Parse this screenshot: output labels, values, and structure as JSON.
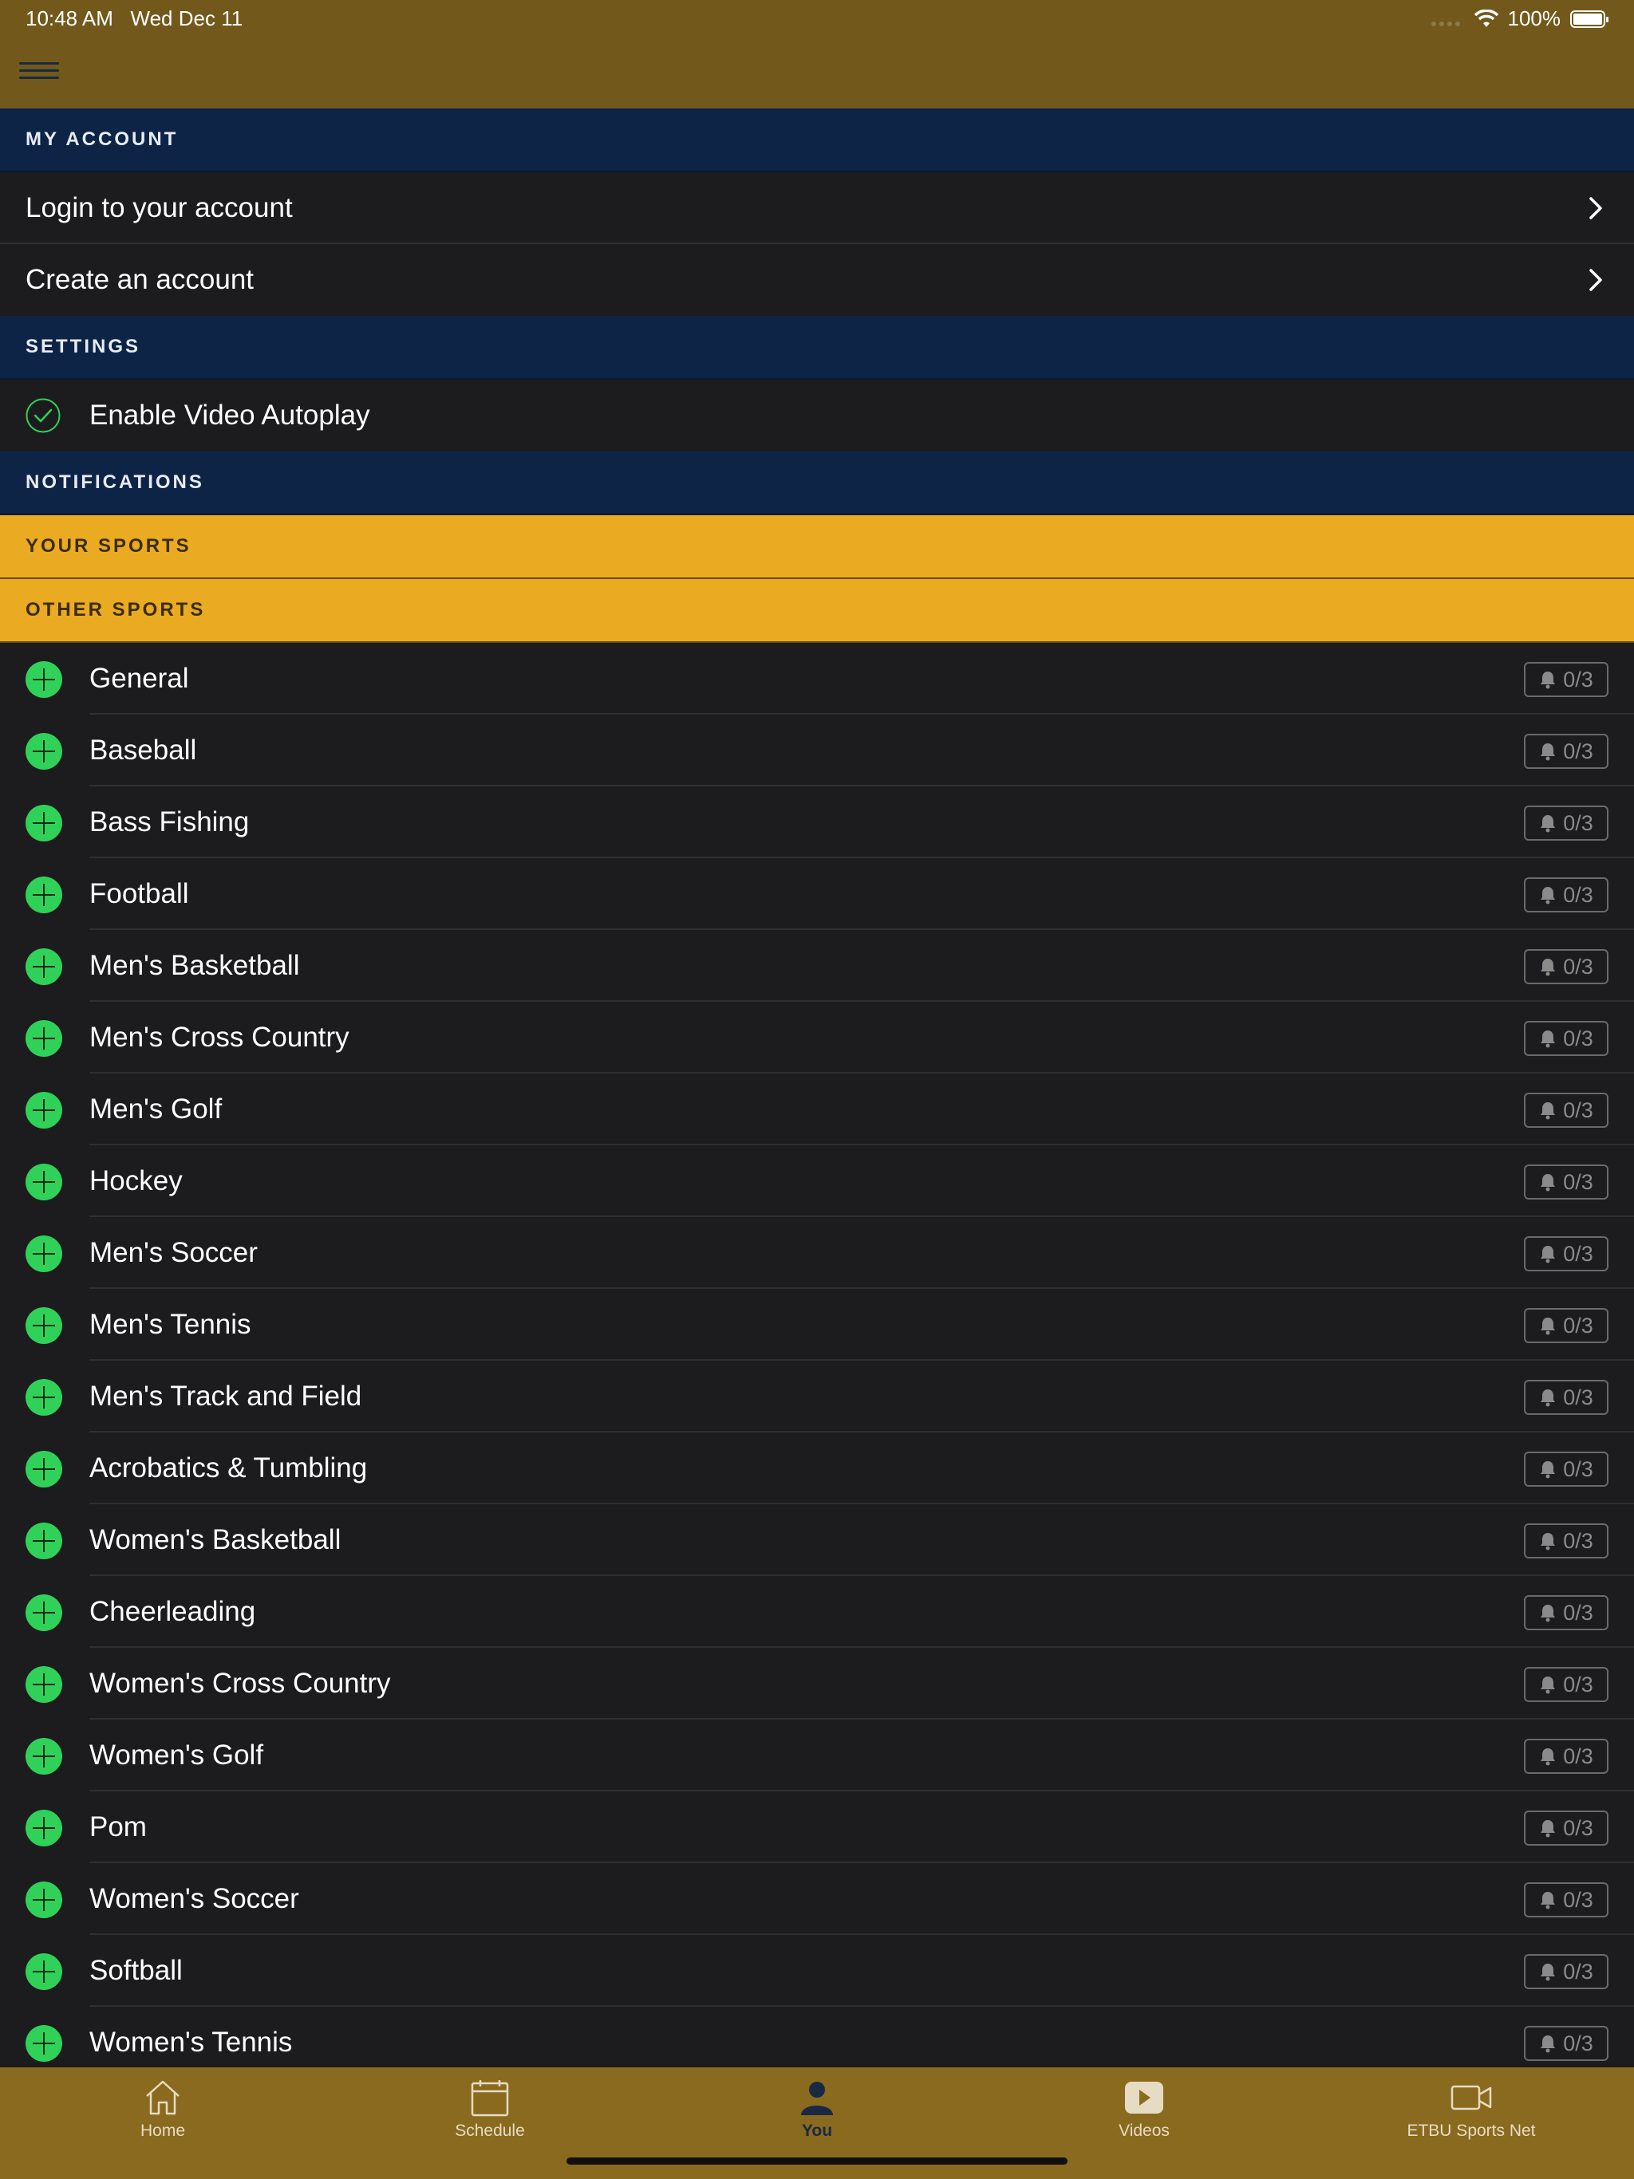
{
  "status": {
    "time": "10:48 AM",
    "date": "Wed Dec 11",
    "battery": "100%"
  },
  "nav": {
    "menu_icon": "hamburger-menu-icon"
  },
  "sections": {
    "my_account": "MY ACCOUNT",
    "settings": "SETTINGS",
    "notifications": "NOTIFICATIONS",
    "your_sports": "YOUR SPORTS",
    "other_sports": "OTHER SPORTS"
  },
  "account": {
    "items": [
      {
        "label": "Login to your account"
      },
      {
        "label": "Create an account"
      }
    ]
  },
  "settings": {
    "items": [
      {
        "label": "Enable Video Autoplay",
        "checked": true
      }
    ]
  },
  "sports": {
    "items": [
      {
        "label": "General",
        "badge": "0/3"
      },
      {
        "label": "Baseball",
        "badge": "0/3"
      },
      {
        "label": "Bass Fishing",
        "badge": "0/3"
      },
      {
        "label": "Football",
        "badge": "0/3"
      },
      {
        "label": "Men's Basketball",
        "badge": "0/3"
      },
      {
        "label": "Men's Cross Country",
        "badge": "0/3"
      },
      {
        "label": "Men's Golf",
        "badge": "0/3"
      },
      {
        "label": "Hockey",
        "badge": "0/3"
      },
      {
        "label": "Men's Soccer",
        "badge": "0/3"
      },
      {
        "label": "Men's Tennis",
        "badge": "0/3"
      },
      {
        "label": "Men's Track and Field",
        "badge": "0/3"
      },
      {
        "label": "Acrobatics & Tumbling",
        "badge": "0/3"
      },
      {
        "label": "Women's Basketball",
        "badge": "0/3"
      },
      {
        "label": "Cheerleading",
        "badge": "0/3"
      },
      {
        "label": "Women's Cross Country",
        "badge": "0/3"
      },
      {
        "label": "Women's Golf",
        "badge": "0/3"
      },
      {
        "label": "Pom",
        "badge": "0/3"
      },
      {
        "label": "Women's Soccer",
        "badge": "0/3"
      },
      {
        "label": "Softball",
        "badge": "0/3"
      },
      {
        "label": "Women's Tennis",
        "badge": "0/3"
      }
    ]
  },
  "tabs": {
    "items": [
      {
        "label": "Home",
        "icon": "home-icon"
      },
      {
        "label": "Schedule",
        "icon": "calendar-icon"
      },
      {
        "label": "You",
        "icon": "person-icon",
        "active": true
      },
      {
        "label": "Videos",
        "icon": "play-icon"
      },
      {
        "label": "ETBU Sports Net",
        "icon": "video-camera-icon"
      }
    ]
  },
  "colors": {
    "nav_bar": "#72591b",
    "section_navy": "#0d2447",
    "section_gold": "#eaaa22",
    "accent_green": "#30d158",
    "tab_bar": "#8a6a1e"
  }
}
